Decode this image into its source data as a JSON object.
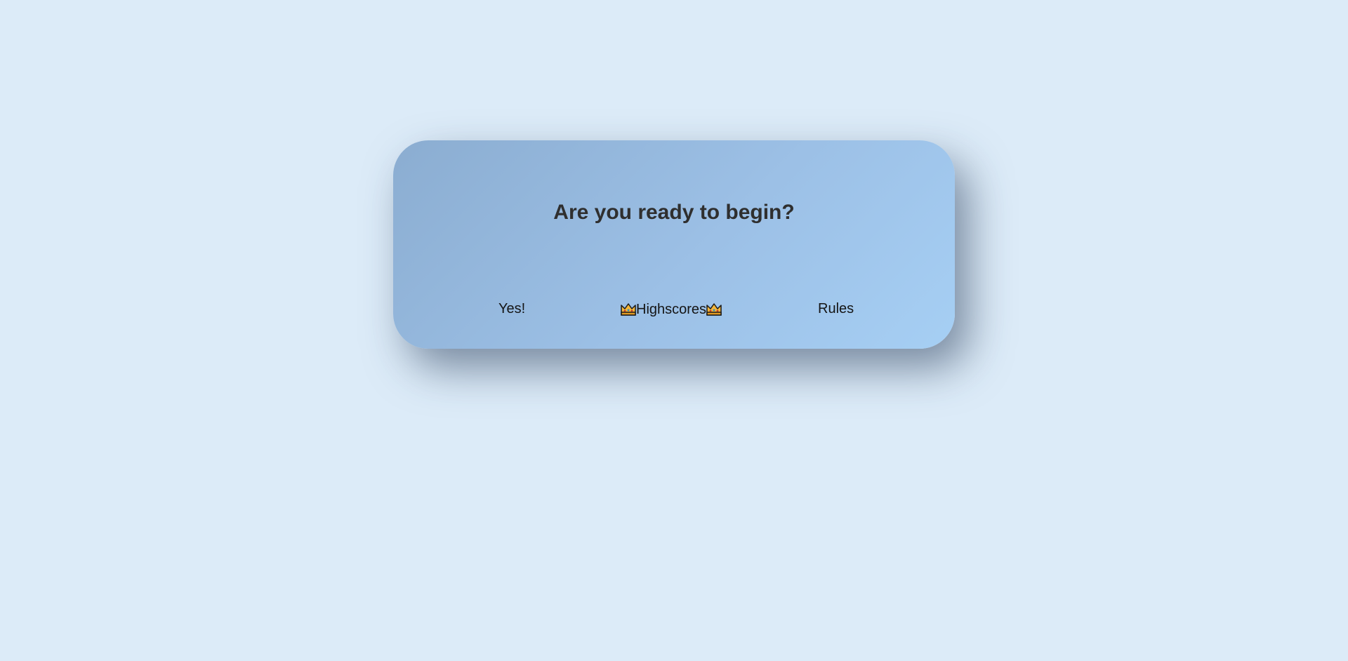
{
  "dialog": {
    "title": "Are you ready to begin?",
    "buttons": {
      "yes_label": "Yes!",
      "highscores_label": "Highscores",
      "rules_label": "Rules"
    },
    "icons": {
      "highscores_left": "crown-icon",
      "highscores_right": "crown-icon"
    }
  },
  "colors": {
    "background": "#dcebf8",
    "card_gradient_start": "#8badd1",
    "card_gradient_end": "#a6cff4",
    "title_text": "#2f2f2f",
    "crown_fill": "#f4b73a"
  }
}
